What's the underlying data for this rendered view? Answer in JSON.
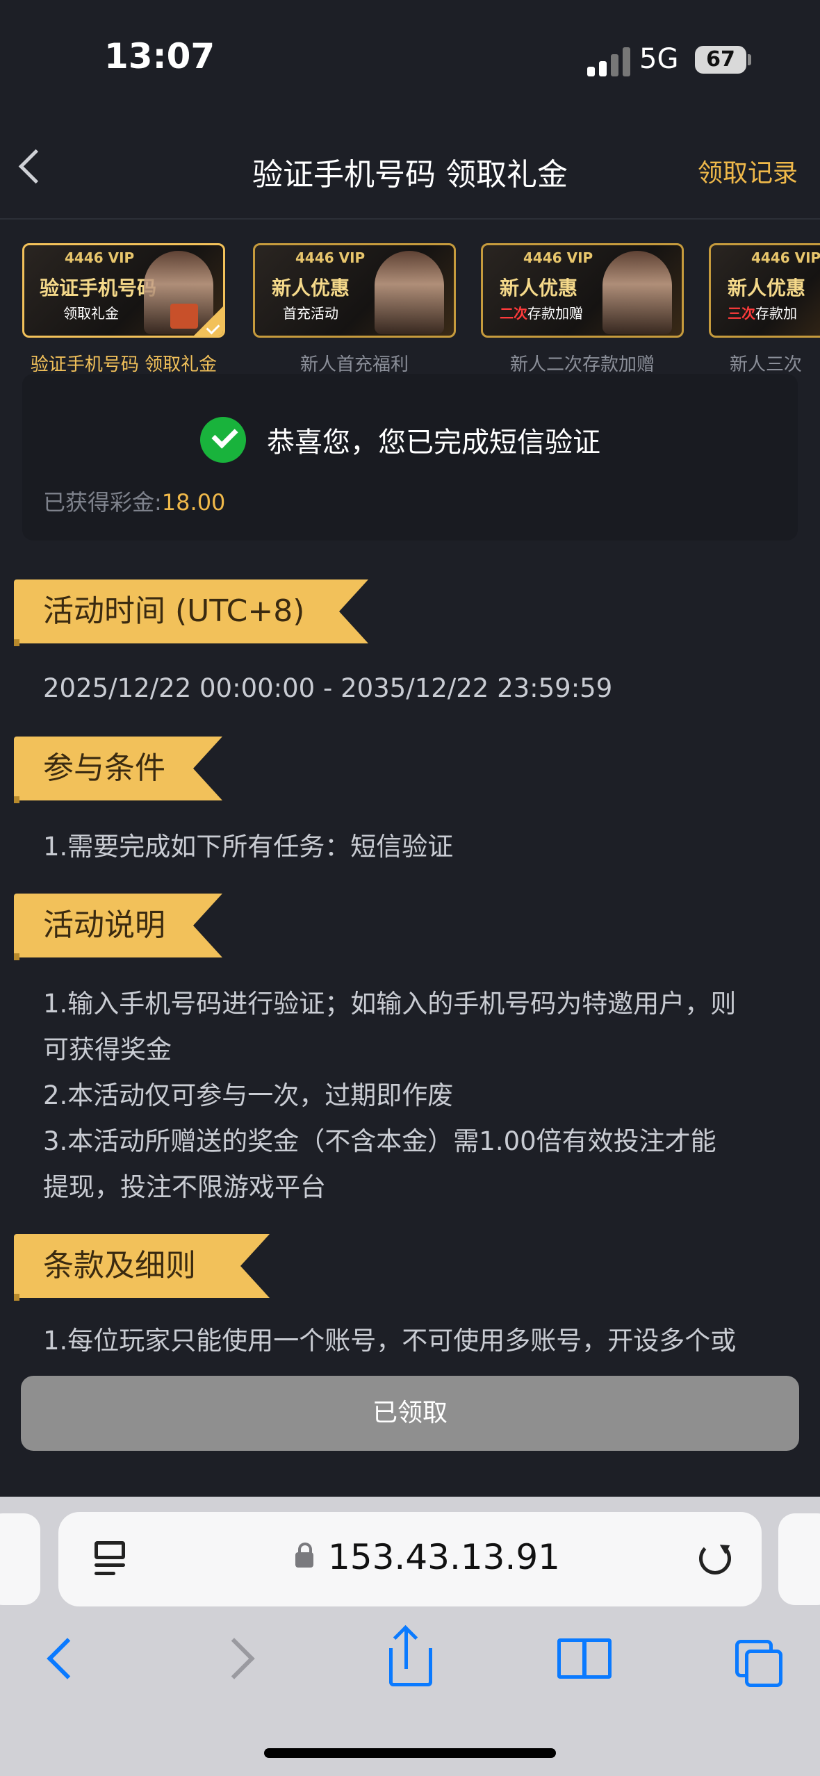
{
  "status_bar": {
    "time": "13:07",
    "network": "5G",
    "battery": "67"
  },
  "header": {
    "title": "验证手机号码 领取礼金",
    "records_label": "领取记录"
  },
  "banners": [
    {
      "vip": "4446 VIP",
      "line1": "验证手机号码",
      "line2": "领取礼金",
      "caption": "验证手机号码 领取礼金"
    },
    {
      "vip": "4446 VIP",
      "line1": "新人优惠",
      "line2": "首充活动",
      "caption": "新人首充福利"
    },
    {
      "vip": "4446 VIP",
      "line1": "新人优惠",
      "line2_red": "二次",
      "line2_rest": "存款加赠",
      "caption": "新人二次存款加赠"
    },
    {
      "vip": "4446 VIP",
      "line1": "新人优惠",
      "line2_red": "三次",
      "line2_rest": "存款加",
      "caption": "新人三次"
    }
  ],
  "success": {
    "message": "恭喜您，您已完成短信验证",
    "earned_label": "已获得彩金:",
    "earned_value": "18.00"
  },
  "sections": {
    "time": {
      "title": "活动时间 (UTC+8)",
      "text": "2025/12/22 00:00:00 - 2035/12/22 23:59:59"
    },
    "conditions": {
      "title": "参与条件",
      "text": "1.需要完成如下所有任务：短信验证"
    },
    "description": {
      "title": "活动说明",
      "lines": [
        "1.输入手机号码进行验证；如输入的手机号码为特邀用户，则",
        "可获得奖金",
        "2.本活动仅可参与一次，过期即作废",
        "3.本活动所赠送的奖金（不含本金）需1.00倍有效投注才能",
        "提现，投注不限游戏平台"
      ]
    },
    "terms": {
      "title": "条款及细则",
      "text": "1.每位玩家只能使用一个账号，不可使用多账号，开设多个或"
    }
  },
  "claim_button": "已领取",
  "browser": {
    "url": "153.43.13.91"
  },
  "colors": {
    "accent": "#f2c15a",
    "success": "#19b33c",
    "ios_blue": "#0a7aff"
  }
}
